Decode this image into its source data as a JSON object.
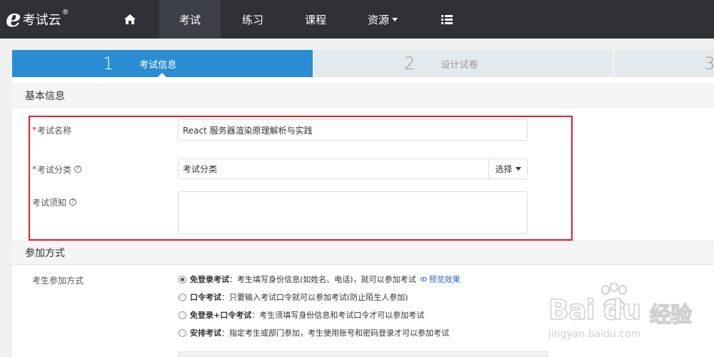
{
  "brand": {
    "logo_letter": "e",
    "name": "考试云",
    "reg": "®"
  },
  "nav": {
    "items": [
      {
        "label": "",
        "icon": "home-icon"
      },
      {
        "label": "考试",
        "active": true
      },
      {
        "label": "练习"
      },
      {
        "label": "课程"
      },
      {
        "label": "资源"
      },
      {
        "label": "",
        "icon": "list-icon"
      }
    ]
  },
  "steps": [
    {
      "num": "1",
      "label": "考试信息",
      "active": true
    },
    {
      "num": "2",
      "label": "设计试卷"
    },
    {
      "num": "3",
      "label": ""
    }
  ],
  "basic_info": {
    "title": "基本信息",
    "exam_name": {
      "label": "考试名称",
      "required": "*",
      "value": "React 服务器渲染原理解析与实践"
    },
    "exam_category": {
      "label": "考试分类",
      "required": "*",
      "help": "?",
      "value": "考试分类",
      "button": "选择"
    },
    "exam_notice": {
      "label": "考试须知",
      "help": "?",
      "value": ""
    }
  },
  "join_mode": {
    "title": "参加方式",
    "label": "考生参加方式",
    "options": [
      {
        "title": "免登录考试",
        "desc": "：考生填写身份信息(如姓名、电话)，就可以参加考试",
        "link": "预览效果",
        "checked": true
      },
      {
        "title": "口令考试",
        "desc": "：只要输入考试口令就可以参加考试(防止陌生人参加)",
        "checked": false
      },
      {
        "title": "免登录+口令考试",
        "desc": "：考生须填写身份信息和考试口令才可以参加考试",
        "checked": false
      },
      {
        "title": "安排考试",
        "desc": "：指定考生或部门参加，考生使用账号和密码登录才可以参加考试",
        "checked": false
      }
    ]
  },
  "watermark": {
    "main": "Bai  du",
    "cn": "经验",
    "sub": "jingyan.baidu.com"
  },
  "colors": {
    "navbar": "#2f3136",
    "accent": "#2a8cd2",
    "highlight_box": "#e41e2b",
    "link": "#2a5bd7"
  }
}
